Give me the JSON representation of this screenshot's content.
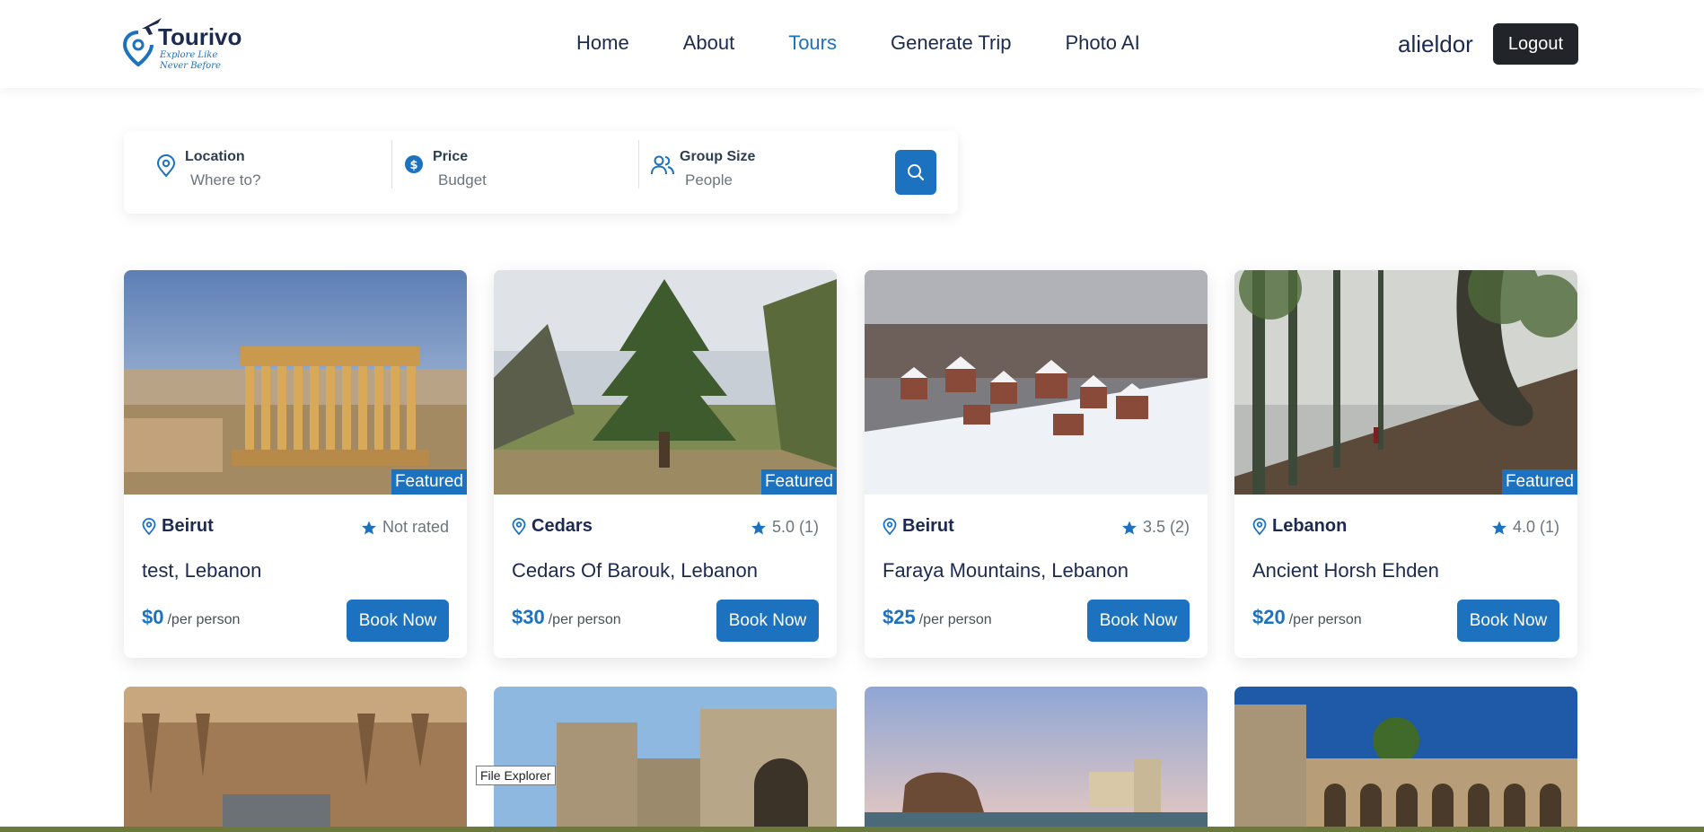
{
  "brand": {
    "name": "Tourivo",
    "tagline": "Explore Like Never Before"
  },
  "nav": {
    "items": [
      {
        "label": "Home",
        "active": false
      },
      {
        "label": "About",
        "active": false
      },
      {
        "label": "Tours",
        "active": true
      },
      {
        "label": "Generate Trip",
        "active": false
      },
      {
        "label": "Photo AI",
        "active": false
      }
    ]
  },
  "user": {
    "name": "alieldor",
    "logout_label": "Logout"
  },
  "search": {
    "location": {
      "label": "Location",
      "placeholder": "Where to?"
    },
    "price": {
      "label": "Price",
      "placeholder": "Budget"
    },
    "group": {
      "label": "Group Size",
      "placeholder": "People"
    }
  },
  "tours": [
    {
      "location": "Beirut",
      "rating": "Not rated",
      "title": "test, Lebanon",
      "price": "$0",
      "per": "/per person",
      "featured": "Featured",
      "book": "Book Now"
    },
    {
      "location": "Cedars",
      "rating": "5.0 (1)",
      "title": "Cedars Of Barouk, Lebanon",
      "price": "$30",
      "per": "/per person",
      "featured": "Featured",
      "book": "Book Now"
    },
    {
      "location": "Beirut",
      "rating": "3.5 (2)",
      "title": "Faraya Mountains, Lebanon",
      "price": "$25",
      "per": "/per person",
      "featured": "",
      "book": "Book Now"
    },
    {
      "location": "Lebanon",
      "rating": "4.0 (1)",
      "title": "Ancient Horsh Ehden",
      "price": "$20",
      "per": "/per person",
      "featured": "Featured",
      "book": "Book Now"
    }
  ],
  "tooltip": "File Explorer",
  "colors": {
    "primary": "#1c72be",
    "dark": "#212529",
    "heading": "#1b2a4e"
  }
}
